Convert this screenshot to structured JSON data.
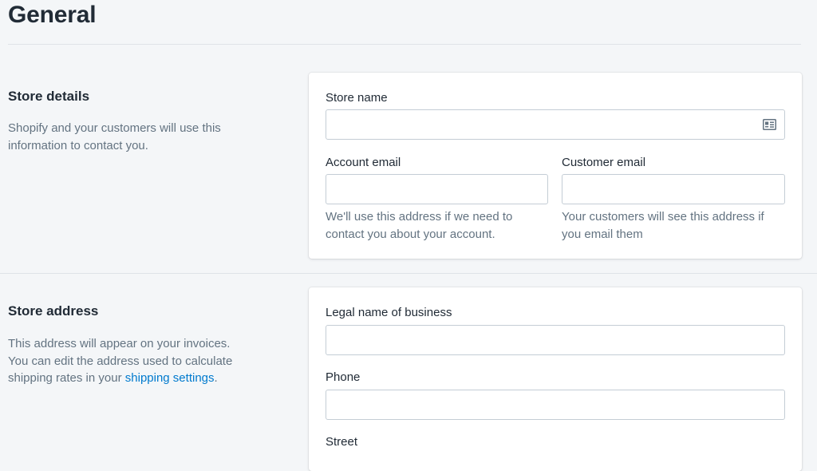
{
  "page": {
    "title": "General"
  },
  "store_details": {
    "heading": "Store details",
    "description": "Shopify and your customers will use this information to contact you.",
    "store_name": {
      "label": "Store name",
      "value": "",
      "icon": "contact-card-icon"
    },
    "account_email": {
      "label": "Account email",
      "value": "",
      "help": "We'll use this address if we need to contact you about your account."
    },
    "customer_email": {
      "label": "Customer email",
      "value": "",
      "help": "Your customers will see this address if you email them"
    }
  },
  "store_address": {
    "heading": "Store address",
    "description_text": "This address will appear on your invoices. You can edit the address used to calculate shipping rates in your",
    "description_link": "shipping settings",
    "description_end": ".",
    "legal_name": {
      "label": "Legal name of business",
      "value": ""
    },
    "phone": {
      "label": "Phone",
      "value": ""
    },
    "street": {
      "label": "Street"
    }
  },
  "colors": {
    "background": "#f4f6f8",
    "card": "#ffffff",
    "link": "#007ace",
    "subdued_text": "#637381",
    "input_border": "#c4cdd5"
  }
}
